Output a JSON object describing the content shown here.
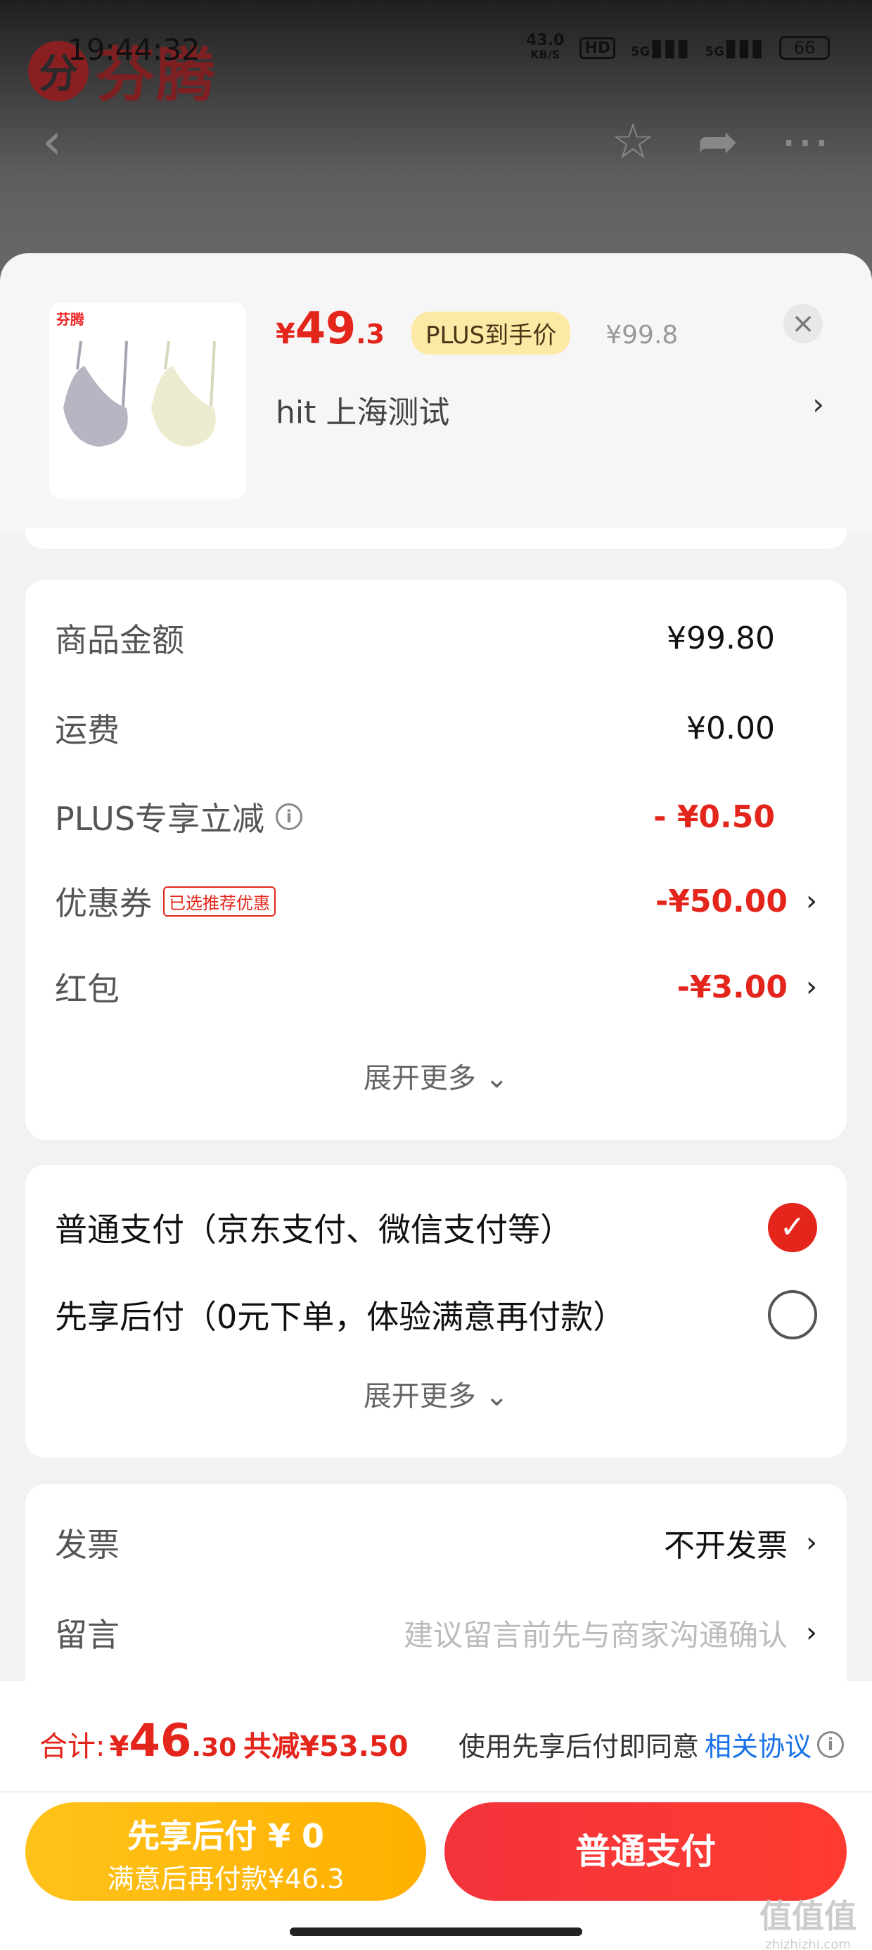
{
  "status": {
    "time": "19:44:32",
    "net_speed": "43.0",
    "net_unit": "KB/S",
    "hd": "HD",
    "sig1": "5G",
    "sig2": "5G",
    "battery": "66"
  },
  "background": {
    "brand_glyph": "分",
    "brand_name": "芬腾"
  },
  "product": {
    "thumb_brand": "芬腾",
    "price_symbol": "¥",
    "price_int": "49",
    "price_dec": ".3",
    "plus_badge": "PLUS到手价",
    "original_price": "¥99.8",
    "address": "hit  上海测试"
  },
  "summary": {
    "goods_label": "商品金额",
    "goods_value": "¥99.80",
    "shipping_label": "运费",
    "shipping_value": "¥0.00",
    "plus_label": "PLUS专享立减",
    "plus_value": "- ¥0.50",
    "coupon_label": "优惠券",
    "coupon_tag": "已选推荐优惠",
    "coupon_value": "-¥50.00",
    "redpacket_label": "红包",
    "redpacket_value": "-¥3.00",
    "expand": "展开更多"
  },
  "payment": {
    "normal_label": "普通支付（京东支付、微信支付等）",
    "bnpl_label": "先享后付（0元下单，体验满意再付款）",
    "expand": "展开更多"
  },
  "extras": {
    "invoice_label": "发票",
    "invoice_value": "不开发票",
    "message_label": "留言",
    "message_placeholder": "建议留言前先与商家沟通确认"
  },
  "bottom": {
    "total_label": "合计:",
    "total_symbol": "¥",
    "total_int": "46",
    "total_dec": ".30",
    "saved": "共减¥53.50",
    "agree_text": "使用先享后付即同意",
    "agree_link": "相关协议",
    "bnpl_line1": "先享后付 ¥ 0",
    "bnpl_line2": "满意后再付款¥46.3",
    "normal_btn": "普通支付"
  },
  "watermark": {
    "main": "值值值",
    "sub": "zhizhizhi.com"
  },
  "colors": {
    "accent_red": "#e4251b",
    "bnpl_yellow": "#ffb000",
    "link_blue": "#1a73e8"
  }
}
